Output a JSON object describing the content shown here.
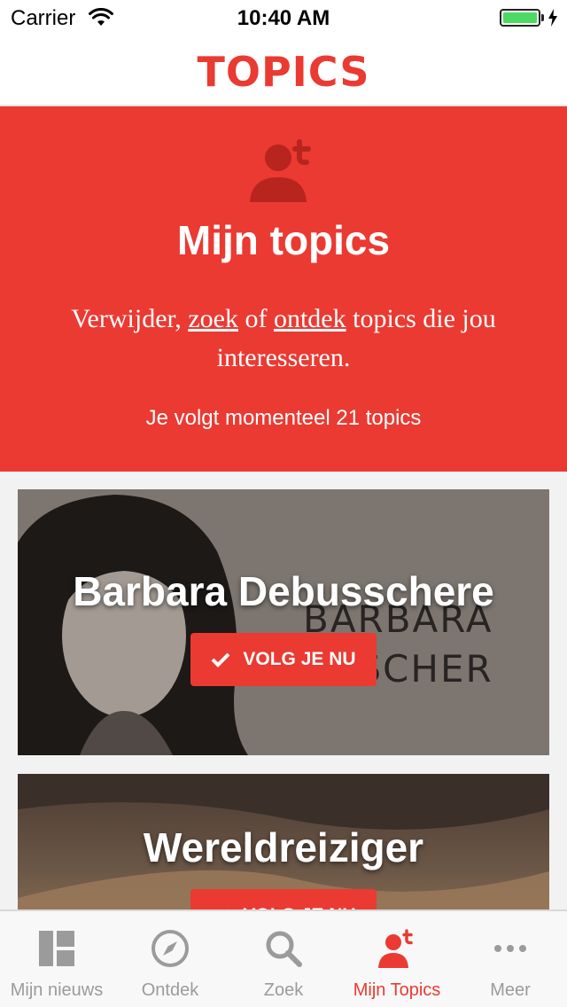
{
  "status_bar": {
    "carrier": "Carrier",
    "time": "10:40 AM",
    "battery_level": 1.0
  },
  "header": {
    "logo": "TOPICS"
  },
  "hero": {
    "icon": "person-topic-icon",
    "title": "Mijn topics",
    "description": {
      "part1": "Verwijder, ",
      "link1": "zoek",
      "part2": " of ",
      "link2": "ontdek",
      "part3": " topics die jou interesseren."
    },
    "count_text": "Je volgt momenteel 21 topics"
  },
  "cards": [
    {
      "title": "Barbara Debusschere",
      "background_text_line1": "BARBARA",
      "background_text_line2": "USSCHER",
      "button_label": "VOLG JE NU",
      "button_icon": "check-icon"
    },
    {
      "title": "Wereldreiziger",
      "button_label": "VOLG JE NU",
      "button_icon": "check-icon"
    }
  ],
  "tab_bar": {
    "tabs": [
      {
        "label": "Mijn nieuws",
        "icon": "dashboard-icon",
        "active": false
      },
      {
        "label": "Ontdek",
        "icon": "compass-icon",
        "active": false
      },
      {
        "label": "Zoek",
        "icon": "search-icon",
        "active": false
      },
      {
        "label": "Mijn Topics",
        "icon": "person-topic-icon",
        "active": true
      },
      {
        "label": "Meer",
        "icon": "more-icon",
        "active": false
      }
    ]
  },
  "colors": {
    "accent": "#ea3a32",
    "inactive_tab": "#9b9b9b",
    "battery": "#4cd964"
  }
}
